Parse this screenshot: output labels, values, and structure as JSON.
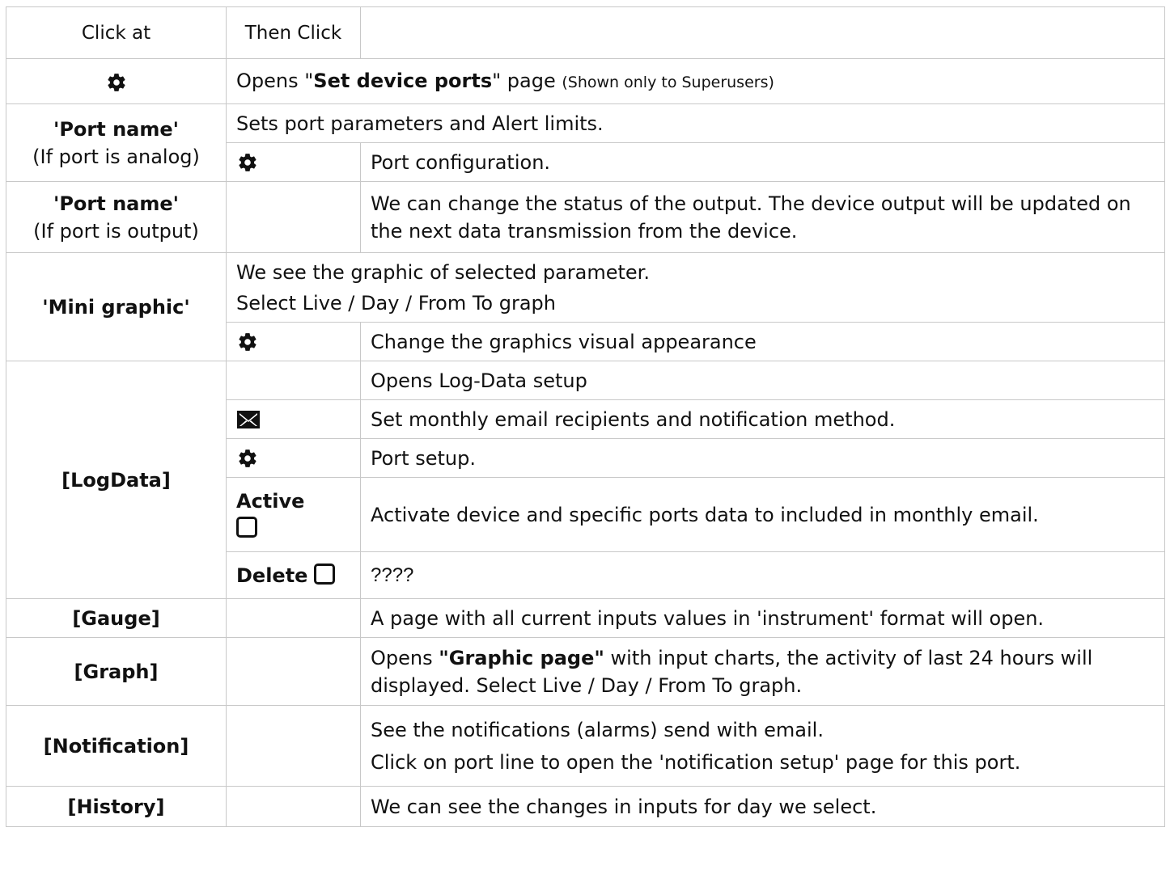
{
  "header": {
    "col1": "Click at",
    "col2": "Then Click",
    "col3": ""
  },
  "row_settings": {
    "icon": "gear-icon",
    "text_a": "Opens \"",
    "text_bold": "Set device ports",
    "text_b": "\" page ",
    "text_small": "(Shown only to Superusers)"
  },
  "row_port_analog": {
    "name": "'Port name'",
    "sub": "(If port is analog)",
    "desc": "Sets port parameters and  Alert limits.",
    "icon": "gear-icon",
    "icon_desc": "Port configuration."
  },
  "row_port_output": {
    "name": "'Port name'",
    "sub": "(If port is output)",
    "desc": "We can change the status of the output.  The device output will be updated on the next data transmission from the device."
  },
  "row_mini_graphic": {
    "name": "'Mini graphic'",
    "desc_line1": "We see the graphic of selected parameter.",
    "desc_line2": "Select Live / Day / From To graph",
    "icon": "gear-icon",
    "icon_desc": "Change the graphics visual appearance"
  },
  "row_logdata": {
    "name": "[LogData]",
    "desc_open": "Opens Log-Data setup",
    "mail_icon": "mail-icon",
    "mail_desc": "Set monthly email recipients and  notification method.",
    "gear_icon": "gear-icon",
    "gear_desc": "Port setup.",
    "active_label": "Active",
    "active_desc": "Activate  device and specific ports data to included in monthly email.",
    "delete_label": "Delete",
    "delete_desc": "????"
  },
  "row_gauge": {
    "name": "[Gauge]",
    "desc": "A page with all current inputs values in 'instrument' format will open."
  },
  "row_graph": {
    "name": "[Graph]",
    "desc_a": "Opens ",
    "desc_bold": "\"Graphic page\"",
    "desc_b": "  with  input charts,  the activity of last 24 hours will displayed.  Select Live / Day / From To graph."
  },
  "row_notification": {
    "name": "[Notification]",
    "desc_line1": "See the notifications (alarms) send with email.",
    "desc_line2": "Click on port line to open the 'notification setup' page for this port."
  },
  "row_history": {
    "name": "[History]",
    "desc": "We can see the changes in inputs for day we select."
  }
}
